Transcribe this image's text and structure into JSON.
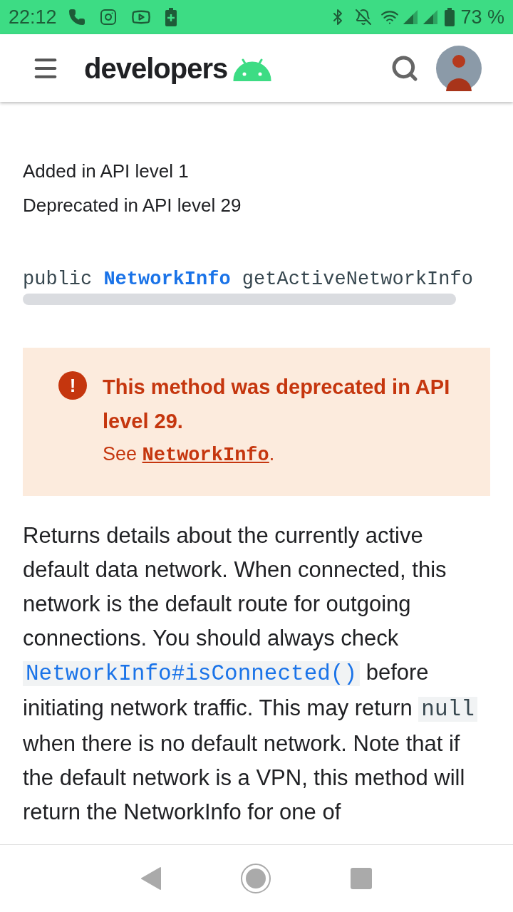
{
  "status_bar": {
    "time": "22:12",
    "battery": "73 %"
  },
  "header": {
    "logo_text": "developers"
  },
  "page": {
    "meta": [
      "Added in API level 1",
      "Deprecated in API level 29"
    ],
    "signature": [
      {
        "kind": "text",
        "text": "public "
      },
      {
        "kind": "link",
        "text": "NetworkInfo"
      },
      {
        "kind": "text",
        "text": " getActiveNetworkInfo"
      }
    ],
    "callout": {
      "icon": "!",
      "title": "This method was deprecated in API level 29.",
      "see": "See ",
      "link": "NetworkInfo",
      "end": "."
    },
    "paragraph": [
      {
        "kind": "text",
        "text": "Returns details about the currently active default data network. When connected, this network is the default route for outgoing connections. You should always check "
      },
      {
        "kind": "link",
        "text": "NetworkInfo#isConnected()"
      },
      {
        "kind": "text",
        "text": " before initiating network traffic. This may return "
      },
      {
        "kind": "code",
        "text": "null"
      },
      {
        "kind": "text",
        "text": " when there is no default network. Note that if the default network is a VPN, this method will return the NetworkInfo for one of"
      }
    ]
  }
}
